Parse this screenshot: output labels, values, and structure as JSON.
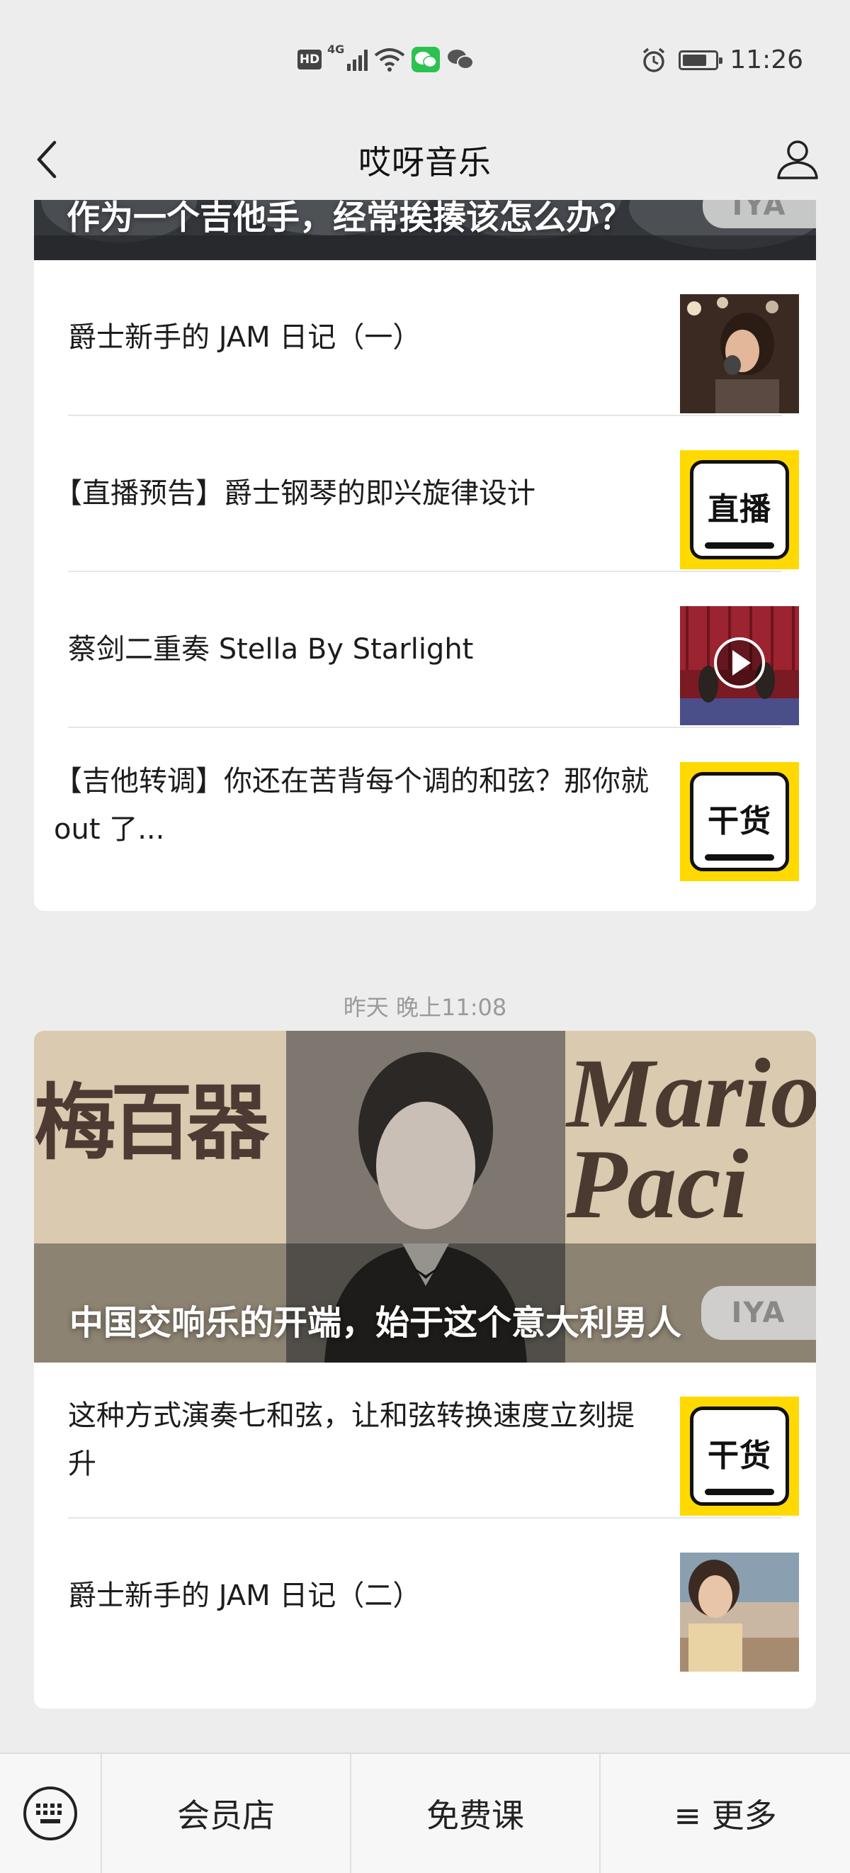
{
  "status_bar": {
    "hd": "HD",
    "network": "4G",
    "wifi_label": "6",
    "time": "11:26",
    "battery_level": 0.75
  },
  "nav": {
    "title": "哎呀音乐",
    "back_icon": "chevron-left-icon",
    "profile_icon": "person-icon"
  },
  "feed": {
    "group1": {
      "hero_title": "作为一个吉他手，经常挨揍该怎么办？",
      "hero_badge": "IYA",
      "items": [
        {
          "title": "爵士新手的 JAM 日记（一）",
          "thumb": "photo-singer"
        },
        {
          "title": "【直播预告】爵士钢琴的即兴旋律设计",
          "thumb": "yellow",
          "thumb_label": "直播"
        },
        {
          "title": "蔡剑二重奏 Stella By Starlight",
          "thumb": "photo-concert"
        },
        {
          "title": "【吉他转调】你还在苦背每个调的和弦？那你就 out 了...",
          "thumb": "yellow",
          "thumb_label": "干货"
        }
      ]
    },
    "group2": {
      "time": "昨天 晚上11:08",
      "hero_title": "中国交响乐的开端，始于这个意大利男人",
      "hero_badge": "IYA",
      "hero_left_text": "梅百器",
      "hero_right_text_1": "Mario",
      "hero_right_text_2": "Paci",
      "items": [
        {
          "title": "这种方式演奏七和弦，让和弦转换速度立刻提升",
          "thumb": "yellow",
          "thumb_label": "干货"
        },
        {
          "title": "爵士新手的 JAM 日记（二）",
          "thumb": "photo-beach"
        }
      ]
    }
  },
  "bottom_menu": {
    "keyboard_icon": "keyboard-icon",
    "items": [
      "会员店",
      "免费课",
      "≡ 更多"
    ]
  }
}
